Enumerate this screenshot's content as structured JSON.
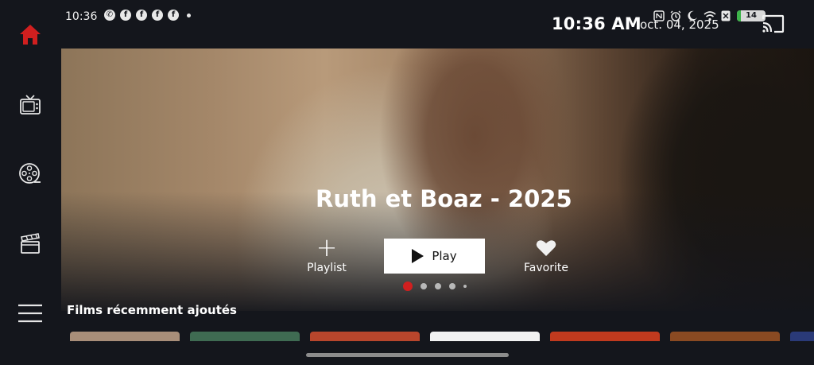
{
  "status_bar": {
    "time": "10:36",
    "notification_icons": [
      "whatsapp-icon",
      "facebook-icon",
      "facebook-icon",
      "facebook-icon",
      "facebook-icon"
    ],
    "clock": "10:36 AM",
    "date": "oct. 04, 2025",
    "battery_level": "14",
    "battery_fraction": 0.14,
    "system_icons": [
      "nfc-icon",
      "alarm-icon",
      "do-not-disturb-icon",
      "wifi-icon",
      "no-sim-icon"
    ]
  },
  "sidebar": {
    "items": [
      {
        "name": "home-icon",
        "active": true
      },
      {
        "name": "tv-icon",
        "active": false
      },
      {
        "name": "film-reel-icon",
        "active": false
      },
      {
        "name": "clapperboard-icon",
        "active": false
      },
      {
        "name": "menu-icon",
        "active": false
      }
    ]
  },
  "hero": {
    "title": "Ruth et Boaz - 2025",
    "playlist_label": "Playlist",
    "play_label": "Play",
    "favorite_label": "Favorite",
    "carousel_position": 1,
    "carousel_count": 5
  },
  "recent": {
    "title": "Films récemment ajoutés",
    "thumbnails": [
      "#a88e79",
      "#3f6b52",
      "#b8462c",
      "#f2f2f2",
      "#c13a1e",
      "#8a4a22",
      "#2a3a78"
    ]
  },
  "colors": {
    "accent": "#d11f1f",
    "background": "#14161c"
  }
}
